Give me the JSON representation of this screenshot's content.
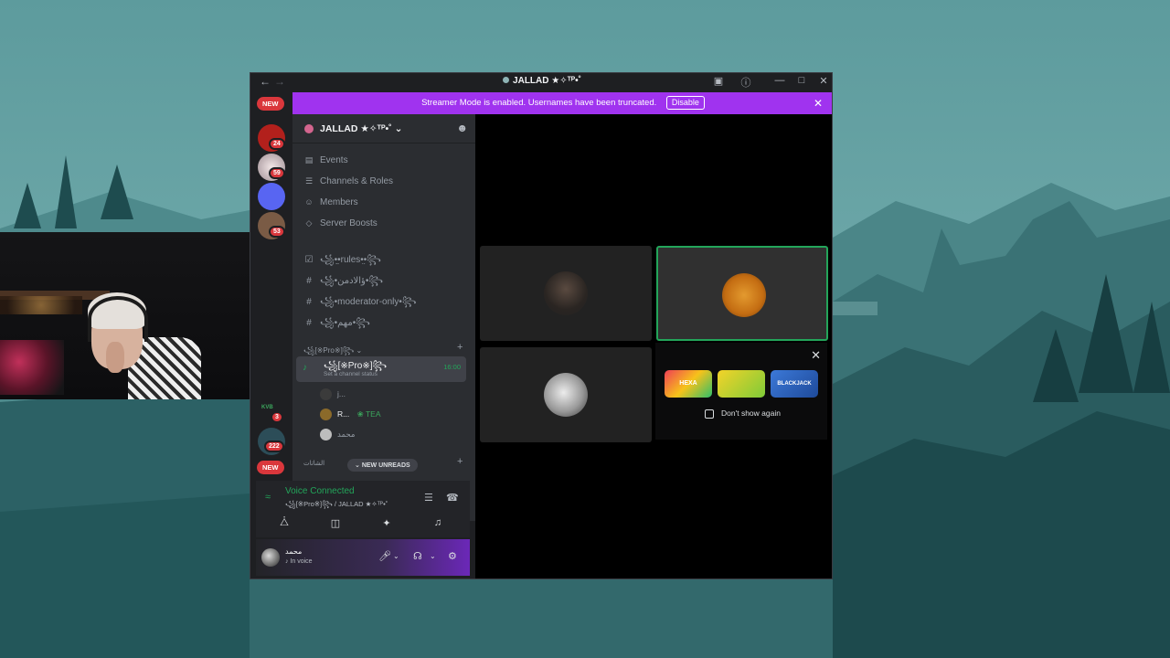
{
  "window": {
    "title": "JALLAD ★✧ᵀᴾ•˚",
    "back_icon": "arrow-left-icon",
    "forward_icon": "arrow-right-icon"
  },
  "banner": {
    "text": "Streamer Mode is enabled. Usernames have been truncated.",
    "disable_label": "Disable",
    "color": "#a033ef"
  },
  "rail": {
    "new_top": "NEW",
    "new_bottom": "NEW",
    "badges": [
      "24",
      "59",
      "53",
      "3",
      "222",
      "10"
    ],
    "guild_label": "KVB"
  },
  "server": {
    "name": "JALLAD ★✧ᵀᴾ•˚",
    "menu": [
      {
        "label": "Events",
        "icon": "calendar-icon"
      },
      {
        "label": "Channels & Roles",
        "icon": "list-icon"
      },
      {
        "label": "Members",
        "icon": "members-icon"
      },
      {
        "label": "Server Boosts",
        "icon": "boost-icon"
      }
    ],
    "channels": [
      {
        "label": "꧁•̤̤•rules•̤•꧂",
        "icon": "check-box-icon"
      },
      {
        "label": "꧁•ؤالادمن•꧂",
        "icon": "hash-icon"
      },
      {
        "label": "꧁•moderator-only•꧂",
        "icon": "hash-icon"
      },
      {
        "label": "꧁•مهم•꧂",
        "icon": "hash-icon"
      }
    ],
    "category": "꧁[※Pro※]꧂",
    "voice_channel": {
      "name": "꧁[※Pro※]꧂",
      "status": "Set a channel status",
      "timer": "16:00"
    },
    "voice_users": [
      {
        "name": "j..."
      },
      {
        "name": "R...",
        "tag": "TEA"
      },
      {
        "name": "محمد"
      }
    ],
    "new_unreads": "NEW UNREADS",
    "category2": "الشاتات"
  },
  "voice_panel": {
    "title": "Voice Connected",
    "subtitle": "꧁[※Pro※]꧂ / JALLAD ★✧ᵀᴾ•˚",
    "accent": "#23a55a"
  },
  "user_panel": {
    "name": "محمد",
    "status": "In voice"
  },
  "activity": {
    "games": [
      "HEXA",
      "",
      "BLACKJACK"
    ],
    "dont_show": "Don't show again"
  }
}
